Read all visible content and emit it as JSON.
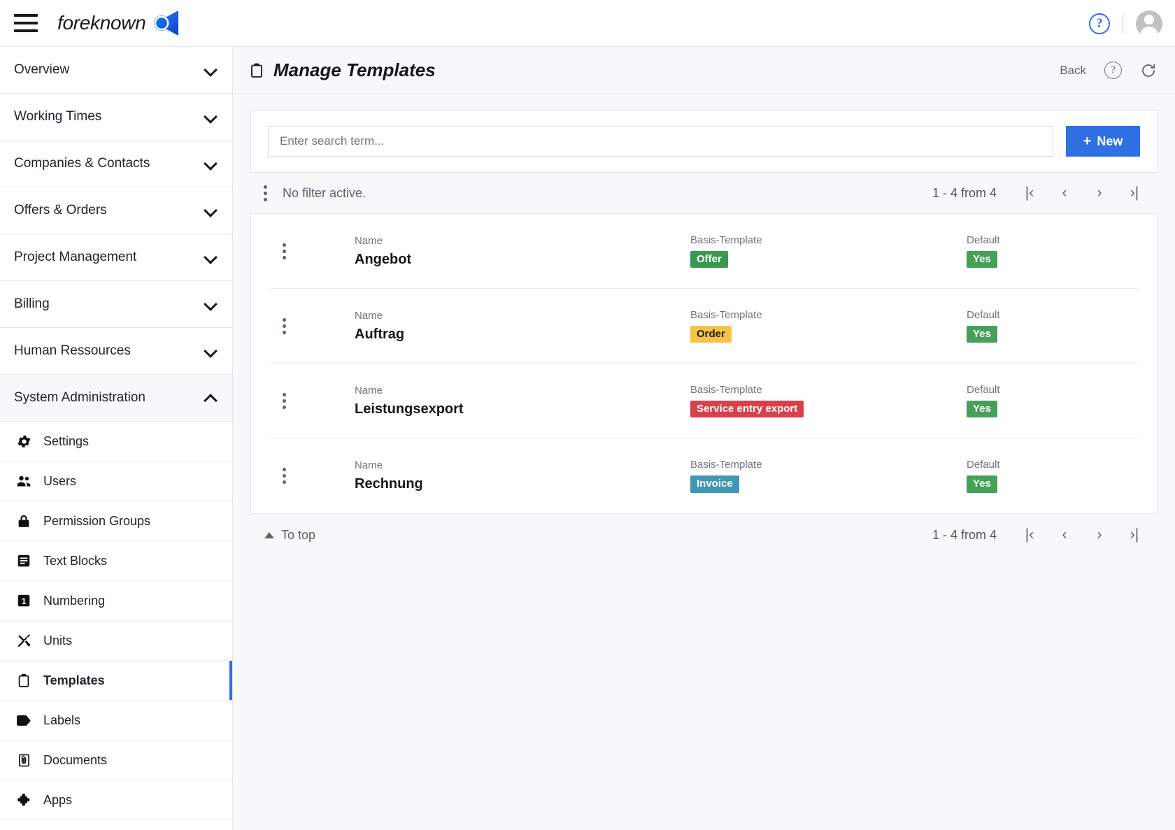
{
  "app": {
    "brand_name": "foreknown",
    "brand_mark_color": "#1565f0",
    "accent_color": "#2f6fe4"
  },
  "topbar": {
    "menu_icon": "hamburger-menu-icon",
    "help_icon_label": "?",
    "avatar_label": "user-avatar"
  },
  "sidebar": {
    "groups": [
      {
        "label": "Overview",
        "expanded": false
      },
      {
        "label": "Working Times",
        "expanded": false
      },
      {
        "label": "Companies & Contacts",
        "expanded": false
      },
      {
        "label": "Offers & Orders",
        "expanded": false
      },
      {
        "label": "Project Management",
        "expanded": false
      },
      {
        "label": "Billing",
        "expanded": false
      },
      {
        "label": "Human Ressources",
        "expanded": false
      },
      {
        "label": "System Administration",
        "expanded": true
      }
    ],
    "items": [
      {
        "label": "Settings",
        "icon": "gear-icon",
        "active": false
      },
      {
        "label": "Users",
        "icon": "users-icon",
        "active": false
      },
      {
        "label": "Permission Groups",
        "icon": "lock-icon",
        "active": false
      },
      {
        "label": "Text Blocks",
        "icon": "text-block-icon",
        "active": false
      },
      {
        "label": "Numbering",
        "icon": "number-one-icon",
        "active": false
      },
      {
        "label": "Units",
        "icon": "tools-icon",
        "active": false
      },
      {
        "label": "Templates",
        "icon": "clipboard-icon",
        "active": true
      },
      {
        "label": "Labels",
        "icon": "tag-icon",
        "active": false
      },
      {
        "label": "Documents",
        "icon": "document-attachment-icon",
        "active": false
      },
      {
        "label": "Apps",
        "icon": "puzzle-piece-icon",
        "active": false
      }
    ]
  },
  "page": {
    "title": "Manage Templates",
    "title_icon": "clipboard-icon",
    "back_label": "Back",
    "help_icon_label": "?",
    "refresh_icon": "refresh-icon"
  },
  "search": {
    "placeholder": "Enter search term...",
    "value": "",
    "new_button_label": "New",
    "new_button_icon": "plus-icon"
  },
  "filterbar": {
    "menu_icon": "kebab-menu-icon",
    "filter_status": "No filter active.",
    "range_text": "1 - 4 from 4",
    "first_icon": "|‹",
    "prev_icon": "‹",
    "next_icon": "›",
    "last_icon": "›|"
  },
  "table": {
    "labels": {
      "name": "Name",
      "basis_template": "Basis-Template",
      "default": "Default"
    },
    "rows": [
      {
        "name": "Angebot",
        "basis_template": "Offer",
        "basis_color": "#3a9950",
        "basis_text_color": "#ffffff",
        "default": "Yes",
        "default_color": "#46a05a"
      },
      {
        "name": "Auftrag",
        "basis_template": "Order",
        "basis_color": "#f6c344",
        "basis_text_color": "#1c1c1c",
        "default": "Yes",
        "default_color": "#46a05a"
      },
      {
        "name": "Leistungsexport",
        "basis_template": "Service entry export",
        "basis_color": "#d94049",
        "basis_text_color": "#ffffff",
        "default": "Yes",
        "default_color": "#46a05a"
      },
      {
        "name": "Rechnung",
        "basis_template": "Invoice",
        "basis_color": "#4098b4",
        "basis_text_color": "#ffffff",
        "default": "Yes",
        "default_color": "#46a05a"
      }
    ]
  },
  "bottombar": {
    "to_top_label": "To top",
    "range_text": "1 - 4 from 4",
    "first_icon": "|‹",
    "prev_icon": "‹",
    "next_icon": "›",
    "last_icon": "›|"
  }
}
